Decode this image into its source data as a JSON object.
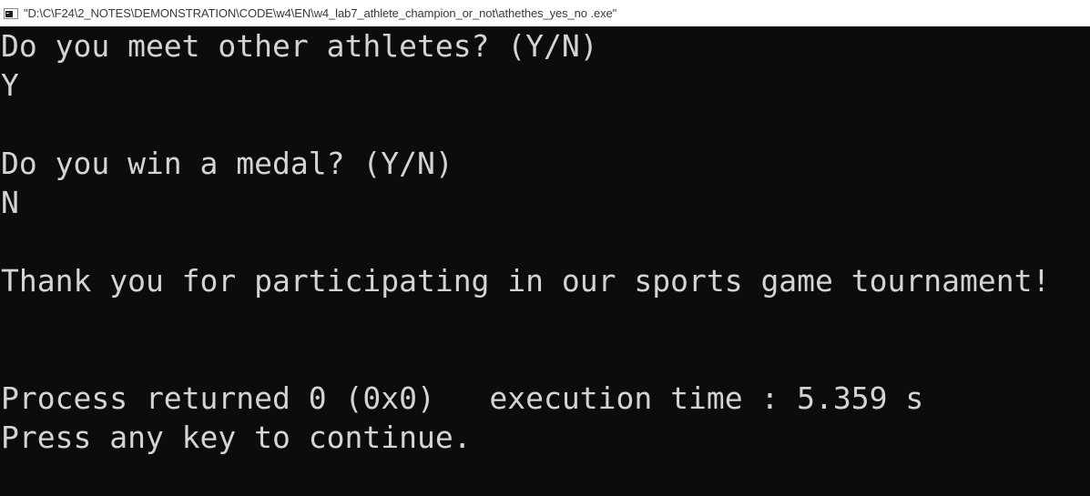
{
  "window": {
    "title": "\"D:\\C\\F24\\2_NOTES\\DEMONSTRATION\\CODE\\w4\\EN\\w4_lab7_athlete_champion_or_not\\athethes_yes_no .exe\""
  },
  "console": {
    "lines": [
      "Do you meet other athletes? (Y/N)",
      "Y",
      "",
      "Do you win a medal? (Y/N)",
      "N",
      "",
      "Thank you for participating in our sports game tournament!",
      "",
      "",
      "Process returned 0 (0x0)   execution time : 5.359 s",
      "Press any key to continue."
    ],
    "text_color": "#d4d4d4",
    "background_color": "#0c0c0c"
  }
}
